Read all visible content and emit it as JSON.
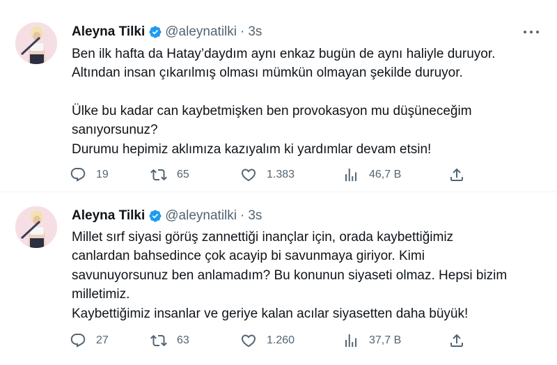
{
  "tweets": [
    {
      "name": "Aleyna Tilki",
      "handle": "@aleynatilki",
      "separator": "·",
      "time": "3s",
      "lines": [
        "Ben ilk hafta da Hatay’daydım aynı enkaz bugün de aynı haliyle duruyor.",
        "Altından insan çıkarılmış olması mümkün olmayan şekilde duruyor.",
        "",
        "Ülke bu kadar can kaybetmişken ben provokasyon mu düşüneceğim",
        "sanıyorsunuz?",
        "Durumu hepimiz aklımıza kazıyalım ki yardımlar devam etsin!"
      ],
      "replies": "19",
      "retweets": "65",
      "likes": "1.383",
      "views": "46,7 B"
    },
    {
      "name": "Aleyna Tilki",
      "handle": "@aleynatilki",
      "separator": "·",
      "time": "3s",
      "lines": [
        "Millet sırf siyasi görüş zannettiği inançlar için, orada kaybettiğimiz",
        "canlardan bahsedince çok acayip bi savunmaya giriyor. Kimi",
        "savunuyorsunuz ben anlamadım? Bu konunun siyaseti olmaz. Hepsi bizim",
        "milletimiz.",
        "Kaybettiğimiz insanlar ve geriye kalan acılar siyasetten daha büyük!"
      ],
      "replies": "27",
      "retweets": "63",
      "likes": "1.260",
      "views": "37,7 B"
    }
  ],
  "icons": {
    "reply": "reply-icon",
    "retweet": "retweet-icon",
    "like": "heart-icon",
    "views": "views-chart-icon",
    "share": "share-icon",
    "verified": "verified-badge-icon",
    "more": "more-dots-icon"
  },
  "colors": {
    "text": "#0f1419",
    "secondary": "#536471",
    "verified": "#1d9bf0",
    "divider": "#eff3f4"
  }
}
